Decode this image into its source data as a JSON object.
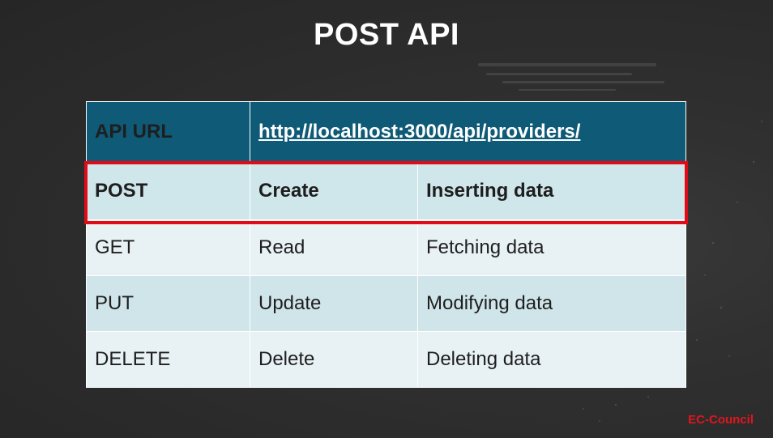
{
  "slide": {
    "title": "POST API"
  },
  "table": {
    "header": {
      "label": "API URL",
      "url": "http://localhost:3000/api/providers/"
    },
    "rows": [
      {
        "method": "POST",
        "operation": "Create",
        "description": "Inserting data"
      },
      {
        "method": "GET",
        "operation": "Read",
        "description": "Fetching data"
      },
      {
        "method": "PUT",
        "operation": "Update",
        "description": "Modifying data"
      },
      {
        "method": "DELETE",
        "operation": "Delete",
        "description": "Deleting data"
      }
    ]
  },
  "logo": {
    "text": "EC-Council"
  },
  "colors": {
    "header_bg": "#0e5a77",
    "highlight_border": "#e10b17",
    "row_light": "#e8f2f4",
    "row_mid": "#d0e5ea",
    "logo": "#e3141d"
  }
}
